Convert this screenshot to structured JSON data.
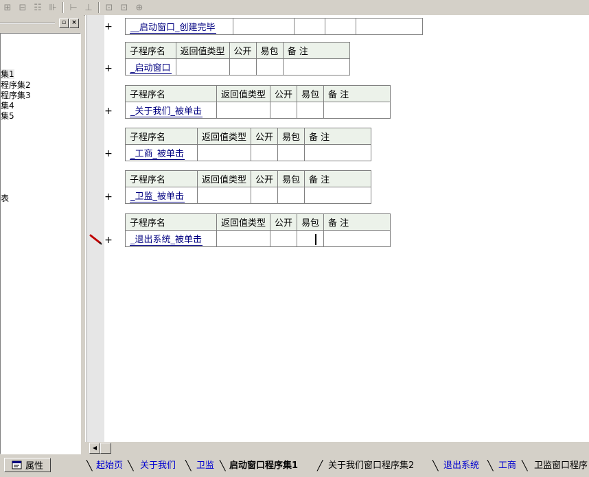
{
  "toolbar": {
    "buttons": [
      "col-insert-icon",
      "row-insert-icon",
      "merge-icon",
      "split-icon",
      "width-icon",
      "height-icon",
      "fit-width-icon",
      "fit-height-icon",
      "fit-all-icon"
    ]
  },
  "left_panel": {
    "tree_items": [
      "集1",
      "程序集2",
      "程序集3",
      "集4",
      "集5",
      "表"
    ]
  },
  "editor": {
    "headers": {
      "name": "子程序名",
      "return_type": "返回值类型",
      "public": "公开",
      "easy": "易包",
      "note": "备 注"
    },
    "plus": "+",
    "subs": [
      {
        "name": "__启动窗口_创建完毕"
      },
      {
        "name": "_启动窗口"
      },
      {
        "name": "_关于我们_被单击"
      },
      {
        "name": "_工商_被单击"
      },
      {
        "name": "_卫监_被单击"
      },
      {
        "name": "_退出系统_被单击"
      }
    ]
  },
  "bottom": {
    "properties_label": "属性",
    "tabs": [
      "起始页",
      "关于我们",
      "卫监",
      "启动窗口程序集1",
      "关于我们窗口程序集2",
      "退出系统",
      "工商",
      "卫监窗口程序"
    ]
  },
  "colors": {
    "header_bg": "#ecf2ea",
    "link_blue": "#0000d0",
    "name_blue": "#000080"
  }
}
